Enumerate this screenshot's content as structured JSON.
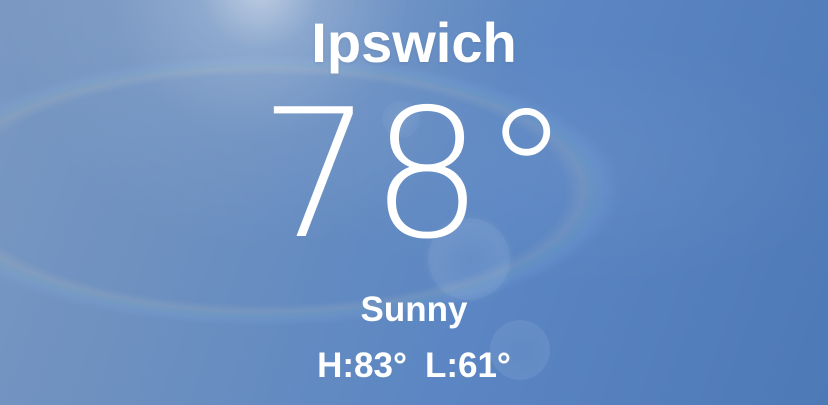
{
  "location": {
    "city": "Ipswich"
  },
  "current": {
    "temperature": "78°",
    "condition": "Sunny",
    "high": "H:83°",
    "low": "L:61°"
  },
  "background": {
    "icon": "sun-lens-flare",
    "colors": [
      "#7a98c2",
      "#5b86c3",
      "#4d79b6"
    ]
  }
}
